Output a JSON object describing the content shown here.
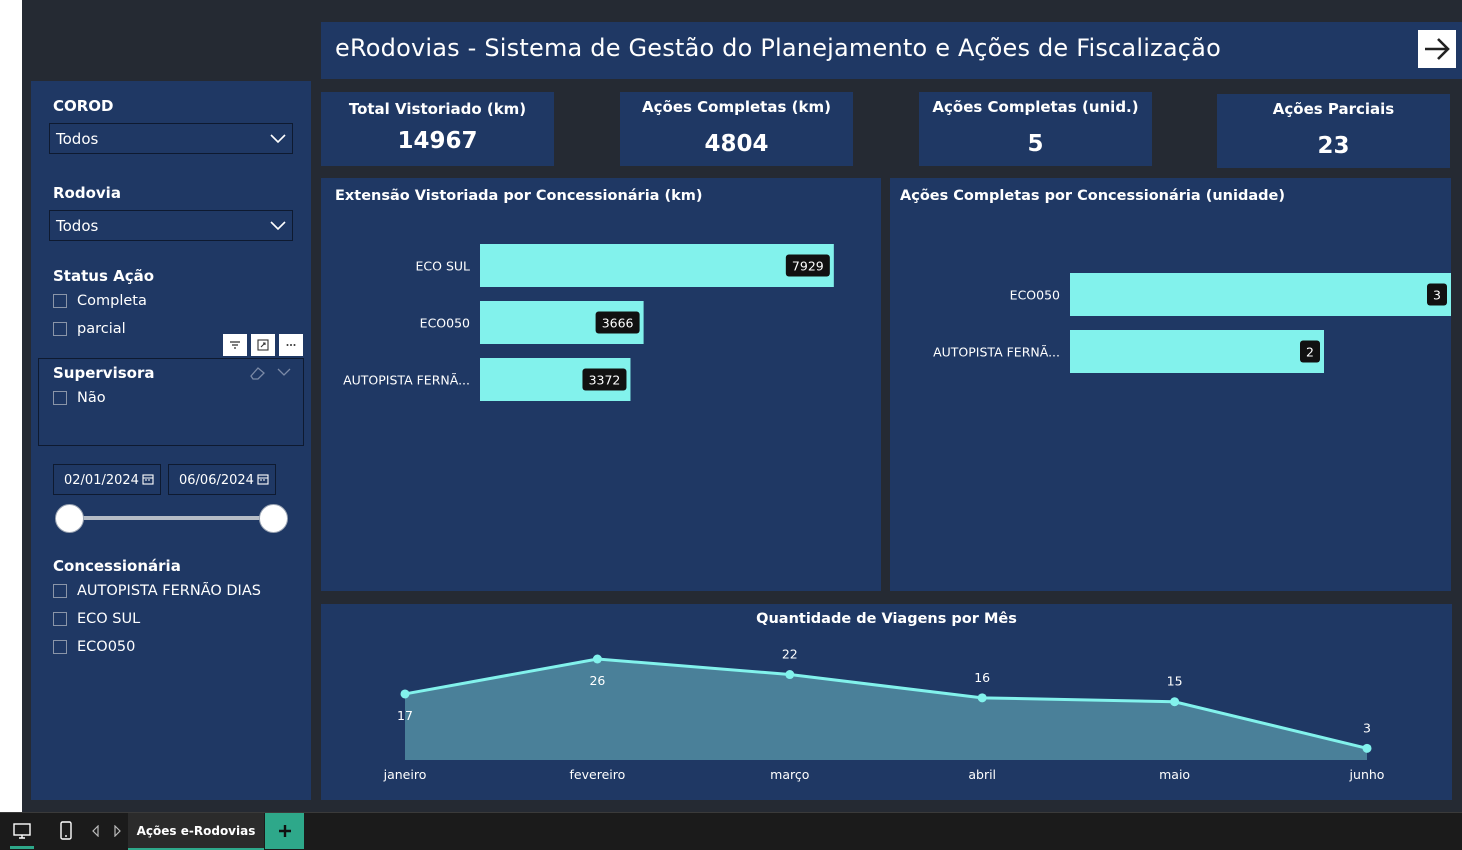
{
  "header": {
    "title": "eRodovias - Sistema de Gestão do Planejamento e Ações de Fiscalização"
  },
  "sidebar": {
    "corod": {
      "label": "COROD",
      "value": "Todos"
    },
    "rodovia": {
      "label": "Rodovia",
      "value": "Todos"
    },
    "status": {
      "label": "Status Ação",
      "options": [
        "Completa",
        "parcial"
      ]
    },
    "supervisora": {
      "label": "Supervisora",
      "options": [
        "Não"
      ]
    },
    "dates": {
      "start": "02/01/2024",
      "end": "06/06/2024"
    },
    "concessionaria": {
      "label": "Concessionária",
      "options": [
        "AUTOPISTA FERNÃO DIAS",
        "ECO SUL",
        "ECO050"
      ]
    }
  },
  "kpis": [
    {
      "label": "Total Vistoriado (km)",
      "value": "14967"
    },
    {
      "label": "Ações Completas (km)",
      "value": "4804"
    },
    {
      "label": "Ações Completas (unid.)",
      "value": "5"
    },
    {
      "label": "Ações Parciais",
      "value": "23"
    }
  ],
  "colors": {
    "panel": "#1f3864",
    "bar": "#82f2ec",
    "area": "#4a8099",
    "background": "#252a33",
    "accent": "#2ea88a"
  },
  "icons": [
    "arrow-right-icon",
    "chevron-down-icon",
    "filter-icon",
    "focus-mode-icon",
    "more-options-icon",
    "eraser-icon",
    "calendar-icon",
    "desktop-icon",
    "mobile-icon",
    "prev-page-icon",
    "next-page-icon",
    "plus-icon"
  ],
  "chart_data": [
    {
      "type": "bar",
      "title": "Extensão Vistoriada por Concessionária (km)",
      "categories": [
        "ECO SUL",
        "ECO050",
        "AUTOPISTA FERNÃ..."
      ],
      "values": [
        7929,
        3666,
        3372
      ],
      "xlim": [
        0,
        8000
      ],
      "grid": false
    },
    {
      "type": "bar",
      "title": "Ações Completas por Concessionária (unidade)",
      "categories": [
        "ECO050",
        "AUTOPISTA FERNÃ..."
      ],
      "values": [
        3,
        2
      ],
      "xlim": [
        0,
        3
      ],
      "grid": false
    },
    {
      "type": "area",
      "title": "Quantidade de Viagens por Mês",
      "categories": [
        "janeiro",
        "fevereiro",
        "março",
        "abril",
        "maio",
        "junho"
      ],
      "values": [
        17,
        26,
        22,
        16,
        15,
        3
      ],
      "ylim": [
        0,
        26
      ],
      "grid": false
    }
  ],
  "bottombar": {
    "page_tab": "Ações e-Rodovias"
  }
}
